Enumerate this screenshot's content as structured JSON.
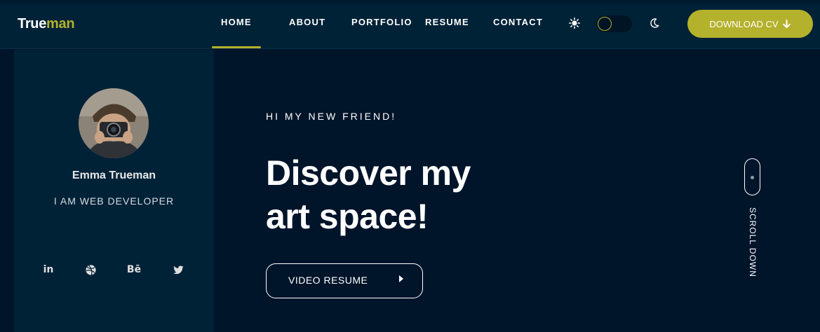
{
  "brand": {
    "part1": "True",
    "part2": "man",
    "accent": "#b4b12c"
  },
  "nav": {
    "items": [
      {
        "label": "HOME",
        "active": true
      },
      {
        "label": "ABOUT"
      },
      {
        "label": "PORTFOLIO"
      },
      {
        "label": "RESUME"
      },
      {
        "label": "CONTACT"
      }
    ],
    "theme_toggle": {
      "light_icon": "sun-icon",
      "dark_icon": "moon-icon"
    },
    "download_label": "DOWNLOAD CV",
    "download_icon": "arrow-down-icon"
  },
  "profile": {
    "name": "Emma Trueman",
    "role": "I AM WEB DEVELOPER",
    "avatar_icon": "profile-photo",
    "social": [
      {
        "icon": "linkedin-icon",
        "text": "in"
      },
      {
        "icon": "dribbble-icon"
      },
      {
        "icon": "behance-icon",
        "text": "Bē"
      },
      {
        "icon": "twitter-icon"
      }
    ]
  },
  "hero": {
    "greeting": "HI MY NEW FRIEND!",
    "headline_line1": "Discover my",
    "headline_line2": "art space!",
    "video_label": "VIDEO RESUME",
    "video_icon": "play-icon",
    "scroll_label": "SCROLL DOWN",
    "scroll_icon": "mouse-icon"
  },
  "colors": {
    "background": "#00142a",
    "panel": "#002237",
    "accent": "#b4b12c",
    "text": "#ffffff"
  }
}
